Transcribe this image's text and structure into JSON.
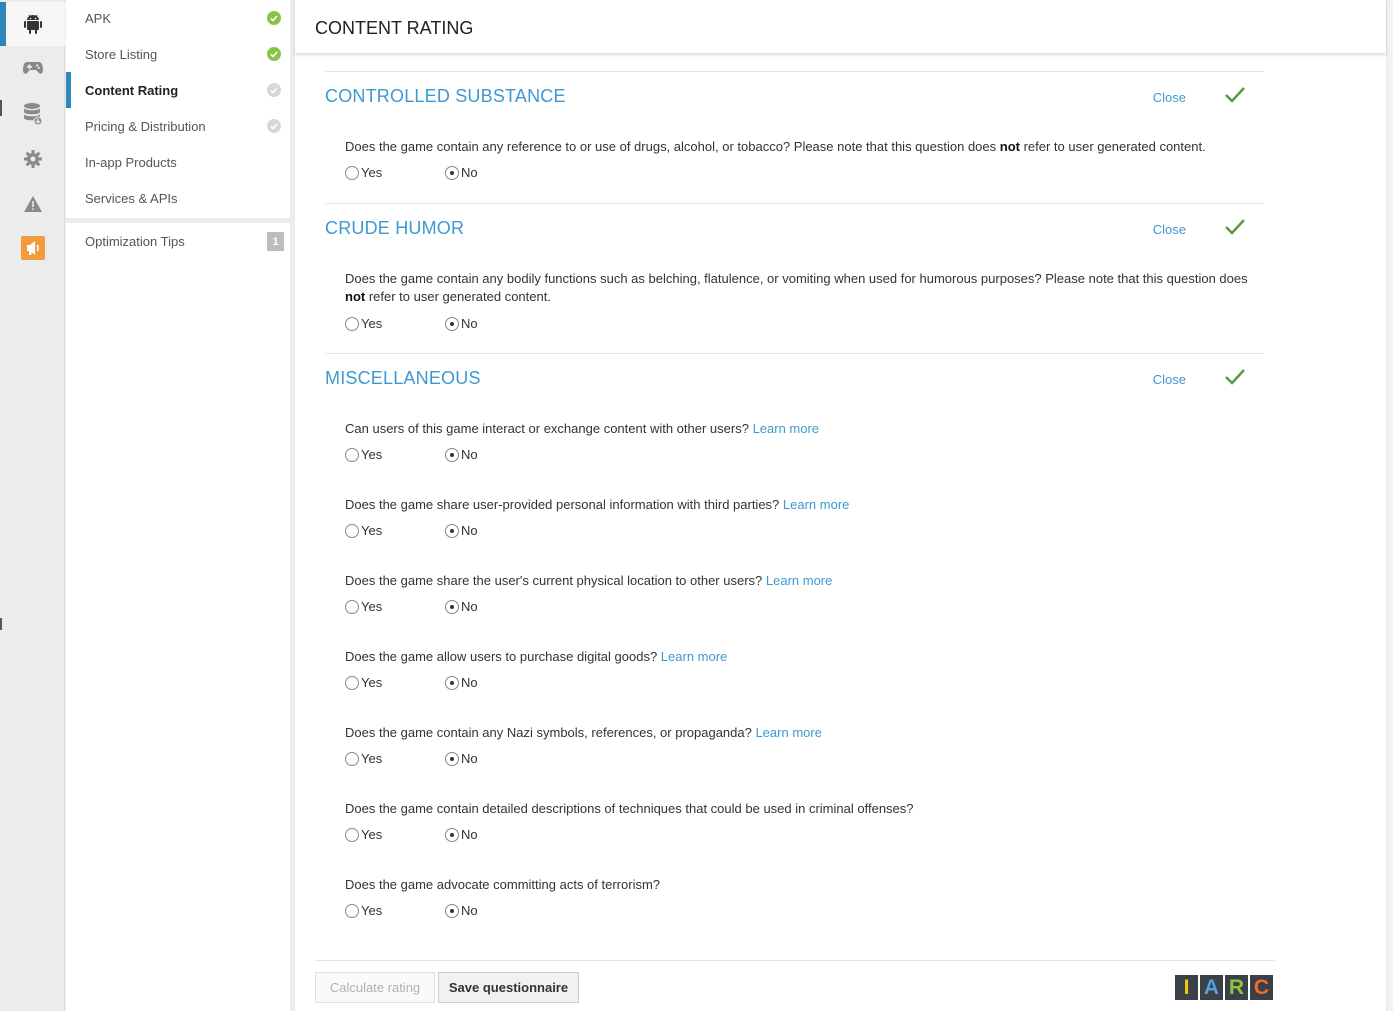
{
  "page": {
    "title": "CONTENT RATING"
  },
  "rail": [
    {
      "icon": "android-icon",
      "active": true
    },
    {
      "icon": "gamepad-icon",
      "active": false
    },
    {
      "icon": "database-download-icon",
      "active": false
    },
    {
      "icon": "gear-icon",
      "active": false
    },
    {
      "icon": "warning-icon",
      "active": false
    },
    {
      "icon": "announcement-icon",
      "active": false,
      "color": "#f39c3c"
    }
  ],
  "nav": {
    "items": [
      {
        "label": "APK",
        "status": "done"
      },
      {
        "label": "Store Listing",
        "status": "done"
      },
      {
        "label": "Content Rating",
        "status": "pending",
        "active": true
      },
      {
        "label": "Pricing & Distribution",
        "status": "pending"
      },
      {
        "label": "In-app Products",
        "status": ""
      },
      {
        "label": "Services & APIs",
        "status": ""
      }
    ],
    "tips": {
      "label": "Optimization Tips",
      "badge": "1"
    }
  },
  "sections": [
    {
      "title": "CONTROLLED SUBSTANCE",
      "close": "Close",
      "questions": [
        {
          "text_before": "Does the game contain any reference to or use of drugs, alcohol, or tobacco? Please note that this question does ",
          "text_bold": "not",
          "text_after": " refer to user generated content.",
          "link": "",
          "yes": "Yes",
          "no": "No",
          "selected": "No"
        }
      ]
    },
    {
      "title": "CRUDE HUMOR",
      "close": "Close",
      "questions": [
        {
          "text_before": "Does the game contain any bodily functions such as belching, flatulence, or vomiting when used for humorous purposes? Please note that this question does ",
          "text_bold": "not",
          "text_after": " refer to user generated content.",
          "link": "",
          "yes": "Yes",
          "no": "No",
          "selected": "No"
        }
      ]
    },
    {
      "title": "MISCELLANEOUS",
      "close": "Close",
      "questions": [
        {
          "text_before": "Can users of this game interact or exchange content with other users? ",
          "text_bold": "",
          "text_after": "",
          "link": "Learn more",
          "yes": "Yes",
          "no": "No",
          "selected": "No"
        },
        {
          "text_before": "Does the game share user-provided personal information with third parties? ",
          "text_bold": "",
          "text_after": "",
          "link": "Learn more",
          "yes": "Yes",
          "no": "No",
          "selected": "No"
        },
        {
          "text_before": "Does the game share the user's current physical location to other users? ",
          "text_bold": "",
          "text_after": "",
          "link": "Learn more",
          "yes": "Yes",
          "no": "No",
          "selected": "No"
        },
        {
          "text_before": "Does the game allow users to purchase digital goods? ",
          "text_bold": "",
          "text_after": "",
          "link": "Learn more",
          "yes": "Yes",
          "no": "No",
          "selected": "No"
        },
        {
          "text_before": "Does the game contain any Nazi symbols, references, or propaganda? ",
          "text_bold": "",
          "text_after": "",
          "link": "Learn more",
          "yes": "Yes",
          "no": "No",
          "selected": "No"
        },
        {
          "text_before": "Does the game contain detailed descriptions of techniques that could be used in criminal offenses?",
          "text_bold": "",
          "text_after": "",
          "link": "",
          "yes": "Yes",
          "no": "No",
          "selected": "No"
        },
        {
          "text_before": "Does the game advocate committing acts of terrorism?",
          "text_bold": "",
          "text_after": "",
          "link": "",
          "yes": "Yes",
          "no": "No",
          "selected": "No"
        }
      ]
    }
  ],
  "footer": {
    "calculate_label": "Calculate rating",
    "save_label": "Save questionnaire",
    "iarc": [
      {
        "letter": "I",
        "color": "#f2c500"
      },
      {
        "letter": "A",
        "color": "#4ea3d8"
      },
      {
        "letter": "R",
        "color": "#8cc43f"
      },
      {
        "letter": "C",
        "color": "#f26a2e"
      }
    ]
  },
  "colors": {
    "accent": "#3d9ad1",
    "success": "#8bc34a",
    "check": "#5a9a3c"
  }
}
